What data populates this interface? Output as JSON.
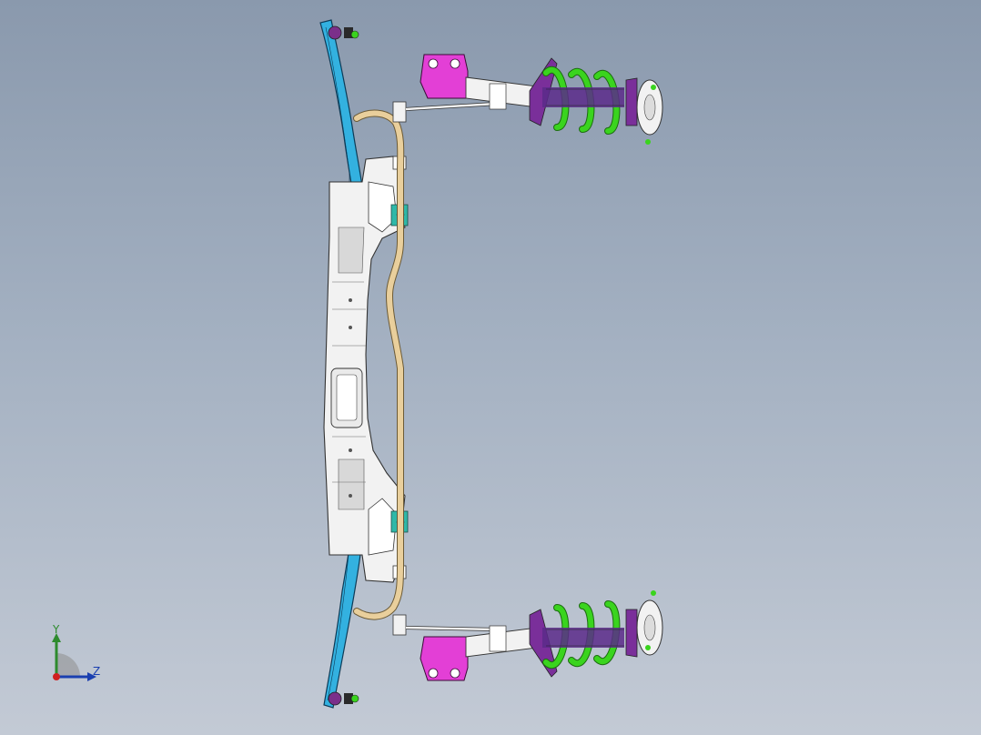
{
  "viewport": {
    "background_top": "#8a99ad",
    "background_bottom": "#c3cad5"
  },
  "assembly": {
    "parts": [
      {
        "name": "front-subframe",
        "color": "#f2f2f2"
      },
      {
        "name": "lower-control-arm",
        "color": "#33b1e0"
      },
      {
        "name": "stabilizer-bar",
        "color": "#e9cf9c"
      },
      {
        "name": "strut-coil-spring",
        "color": "#3ad41e"
      },
      {
        "name": "strut-knuckle-bracket",
        "color": "#e33fd6"
      },
      {
        "name": "shock-absorber-core",
        "color": "#5a2a8a"
      },
      {
        "name": "bushing-accent",
        "color": "#2fb8a8"
      }
    ]
  },
  "triad": {
    "y_label": "Y",
    "z_label": "Z",
    "y_color": "#2e8b2e",
    "z_color": "#1a3fb0",
    "origin_color": "#d02020"
  }
}
